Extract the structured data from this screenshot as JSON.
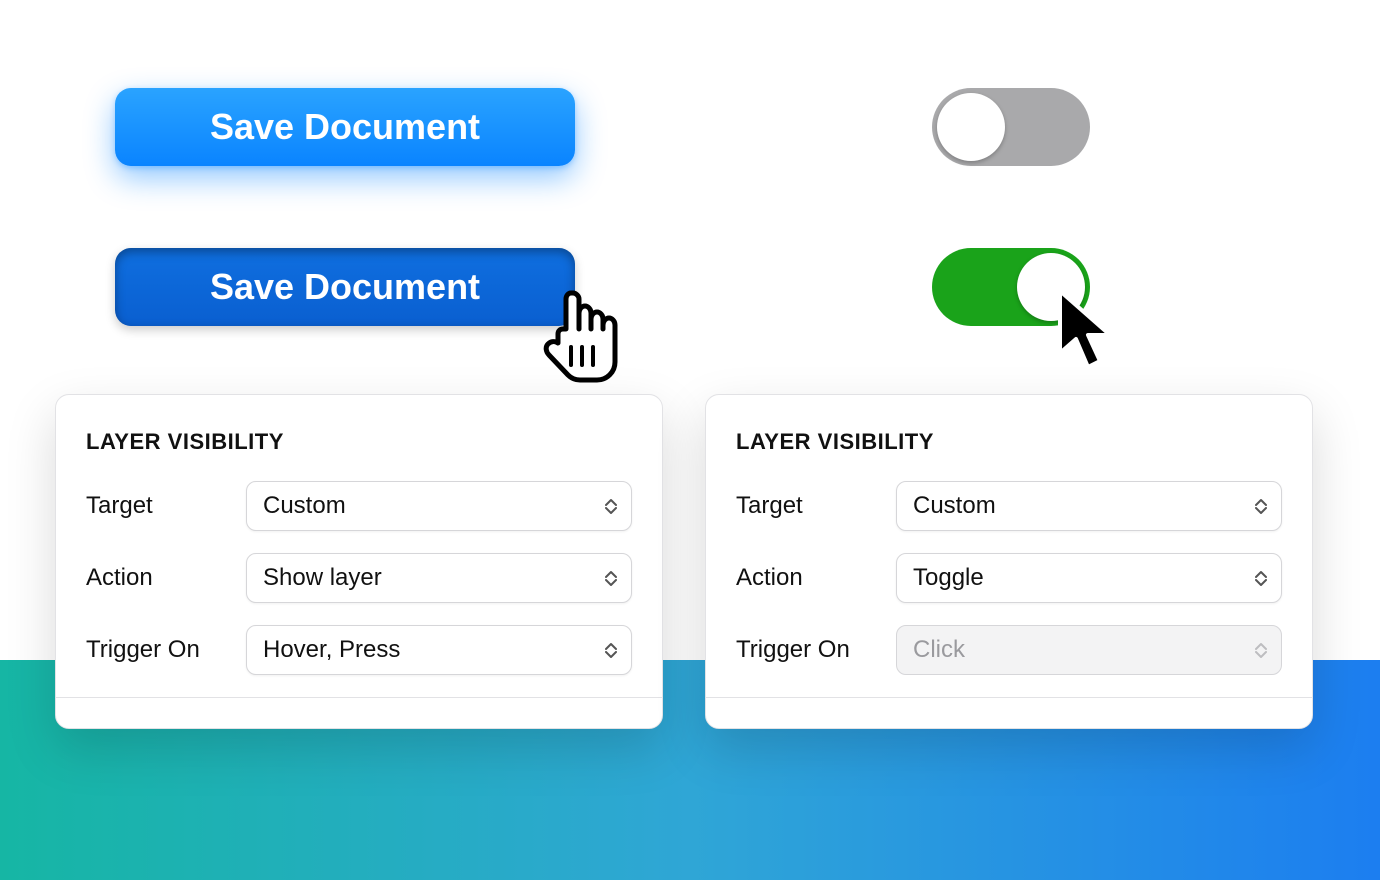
{
  "buttons": {
    "save_normal": "Save Document",
    "save_pressed": "Save Document"
  },
  "panels": {
    "title": "LAYER VISIBILITY",
    "labels": {
      "target": "Target",
      "action": "Action",
      "trigger_on": "Trigger On"
    },
    "left": {
      "target": "Custom",
      "action": "Show layer",
      "trigger_on": "Hover, Press"
    },
    "right": {
      "target": "Custom",
      "action": "Toggle",
      "trigger_on": "Click"
    }
  },
  "toggles": {
    "off_state": "off",
    "on_state": "on"
  }
}
